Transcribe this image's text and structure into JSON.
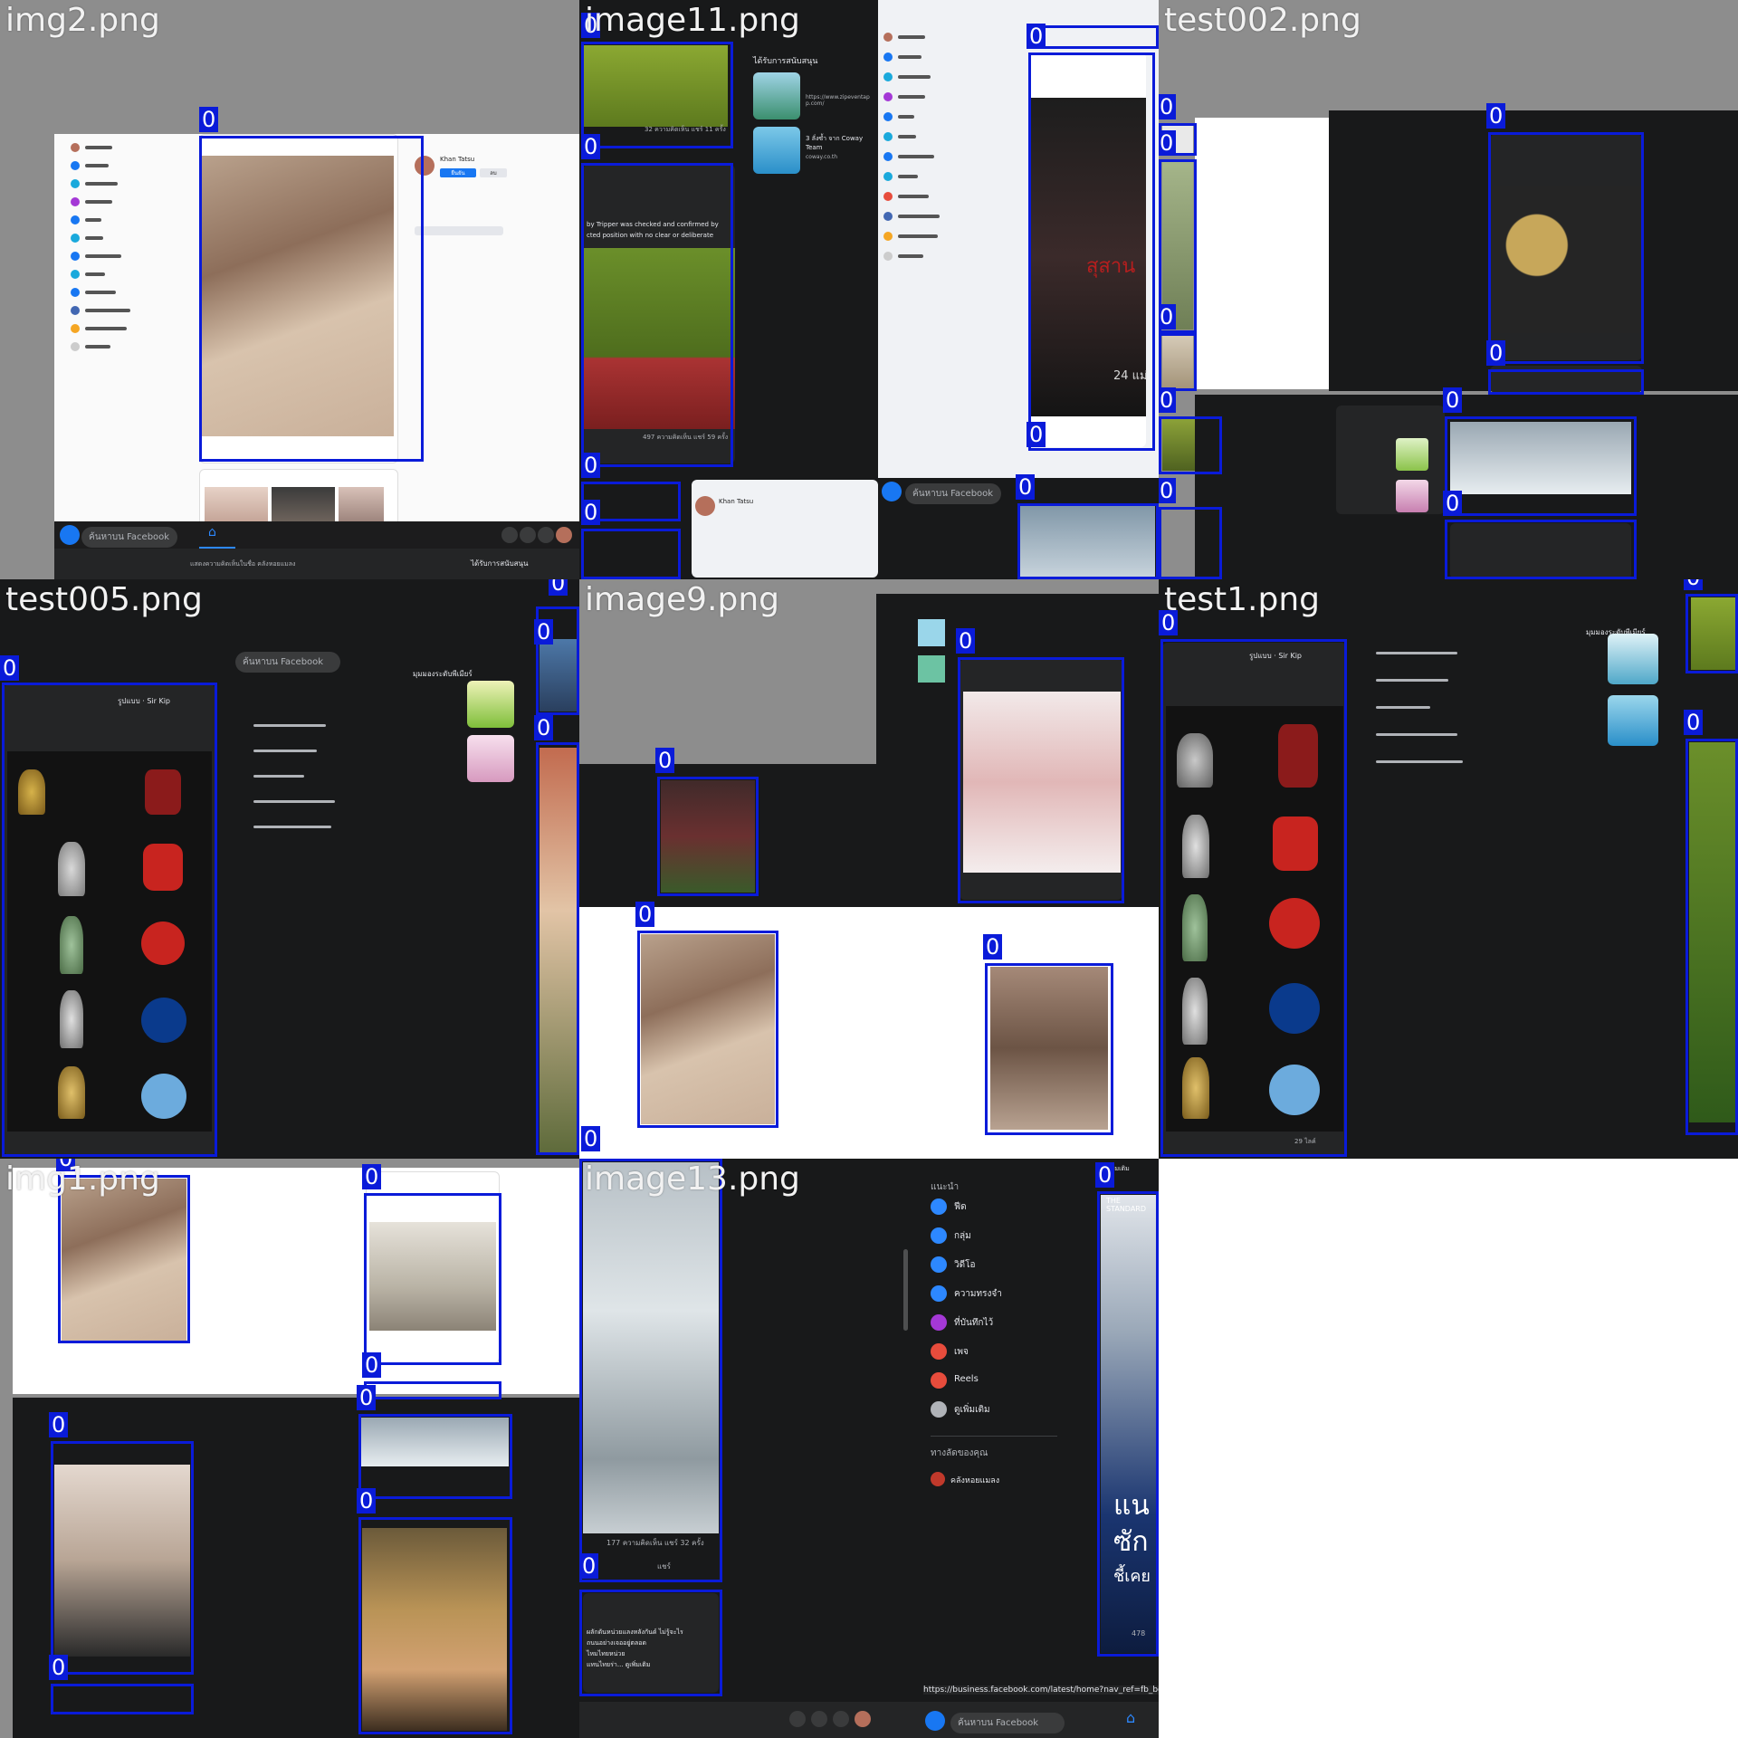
{
  "tiles": [
    {
      "label": "img2.png"
    },
    {
      "label": "image11.png"
    },
    {
      "label": "test002.png"
    },
    {
      "label": "test005.png"
    },
    {
      "label": "image9.png"
    },
    {
      "label": "test1.png"
    },
    {
      "label": "img1.png"
    },
    {
      "label": "image13.png"
    }
  ],
  "detection": {
    "class_label": "0",
    "box_color": "#0a1bd9"
  },
  "facebook": {
    "search_placeholder": "ค้นหาบน Facebook",
    "brand_color": "#1877f2"
  },
  "image13": {
    "sidebar_heading": "แนะนำ",
    "sidebar_items": [
      "ฟีด",
      "กลุ่ม",
      "วิดีโอ",
      "ความทรงจำ",
      "ที่บันทึกไว้",
      "เพจ",
      "Reels",
      "ดูเพิ่มเติม"
    ],
    "shortcuts_heading": "ทางลัดของคุณ",
    "shortcut_item": "คลังหอยแมลง",
    "url_text": "https://business.facebook.com/latest/home?nav_ref=fb_bo",
    "post_stats": "177 ความคิดเห็น  แชร์ 32 ครั้ง",
    "share_label": "แชร์",
    "post_text": [
      "ผลักดันหน่วยแลงหลังกันด์ ไม่รู้จะไร",
      "ถนนอย่างเจออยู่ตลอด",
      "ไหมไทยหน่วย",
      "แทนไทยร่า... ดูเพิ่มเติม"
    ],
    "right_card_header": "ดูเพิ่มเติม",
    "right_card_banner": "THE STANDARD",
    "right_card_text": [
      "แน",
      "ซัก",
      "ชี้เคย"
    ],
    "right_card_count": "478"
  },
  "test1": {
    "page_name": "รูปแบบ · Sir Kip",
    "stat_text": "29 ไลค์",
    "suggest_heading": "มุมมองระดับพีเมียร์",
    "view_label": "ดูเพิ่มเติม"
  },
  "test005": {
    "page_name": "รูปแบบ · Sir Kip",
    "suggest_heading": "มุมมองระดับพีเมียร์"
  },
  "image11": {
    "sponsor_heading": "ได้รับการสนับสนุน",
    "post_stats_1": "32 ความคิดเห็น  แชร์ 11 ครั้ง",
    "post_stats_2": "497 ความคิดเห็น  แชร์ 59 ครั้ง",
    "caption_line": "by Tripper was checked and confirmed by",
    "caption_line_2": "cted position with no clear or deliberate",
    "ad_url": "https://www.zipeventap p.com/",
    "ad_title_2": "3 ลั่งซ้ำ จาก Coway Team",
    "ad_url_2": "coway.co.th",
    "movie_text": "สุสาน",
    "movie_date": "24 แม่",
    "profile_name": "Khan Tatsu"
  },
  "img2": {
    "profile_name": "Khan Tatsu",
    "accept_label": "ยืนยัน",
    "delete_label": "ลบ",
    "sponsor_heading": "ได้รับการสนับสนุน",
    "status_text": "แสดงความคิดเห็นในชื่อ คลังหอยแมลง",
    "tooltip": "หน้าหลัก ชื่อ-นามสกุล"
  }
}
